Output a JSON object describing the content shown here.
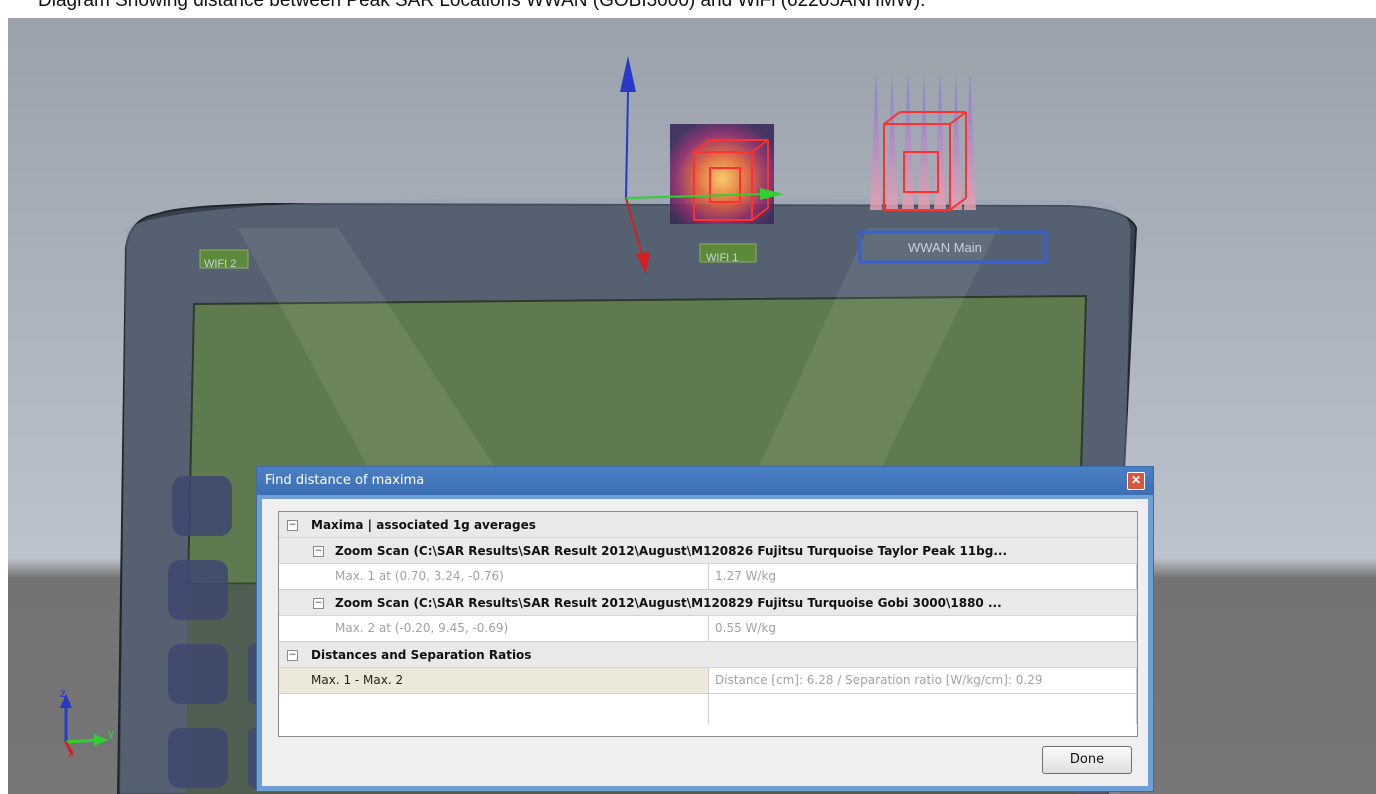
{
  "caption": "Diagram Showing distance between Peak SAR Locations WWAN (GOBI3000) and WiFi (62205ANHMW).",
  "scene": {
    "label_wifi2": "WIFI 2",
    "label_wifi1": "WIFI 1",
    "label_wwan_main": "WWAN Main",
    "axis_z": "z",
    "axis_y": "y",
    "axis_x": "x"
  },
  "dialog": {
    "title": "Find distance of maxima",
    "close_icon": "close-icon",
    "header_maxima": "Maxima | associated 1g averages",
    "zoom_scan_1": "Zoom Scan (C:\\SAR Results\\SAR Result 2012\\August\\M120826 Fujitsu Turquoise Taylor Peak 11bg...",
    "max1_label": "Max. 1 at (0.70, 3.24, -0.76)",
    "max1_value": "1.27 W/kg",
    "zoom_scan_2": "Zoom Scan (C:\\SAR Results\\SAR Result 2012\\August\\M120829 Fujitsu Turquoise Gobi 3000\\1880 ...",
    "max2_label": "Max. 2 at (-0.20, 9.45, -0.69)",
    "max2_value": "0.55 W/kg",
    "header_distances": "Distances and Separation Ratios",
    "pair_label": "Max. 1 - Max. 2",
    "pair_value": "Distance [cm]: 6.28 / Separation ratio [W/kg/cm]: 0.29",
    "expand_glyph": "⊟",
    "done_label": "Done"
  },
  "colors": {
    "title_bar": "#3d6eb3",
    "close_button": "#d6563f"
  }
}
